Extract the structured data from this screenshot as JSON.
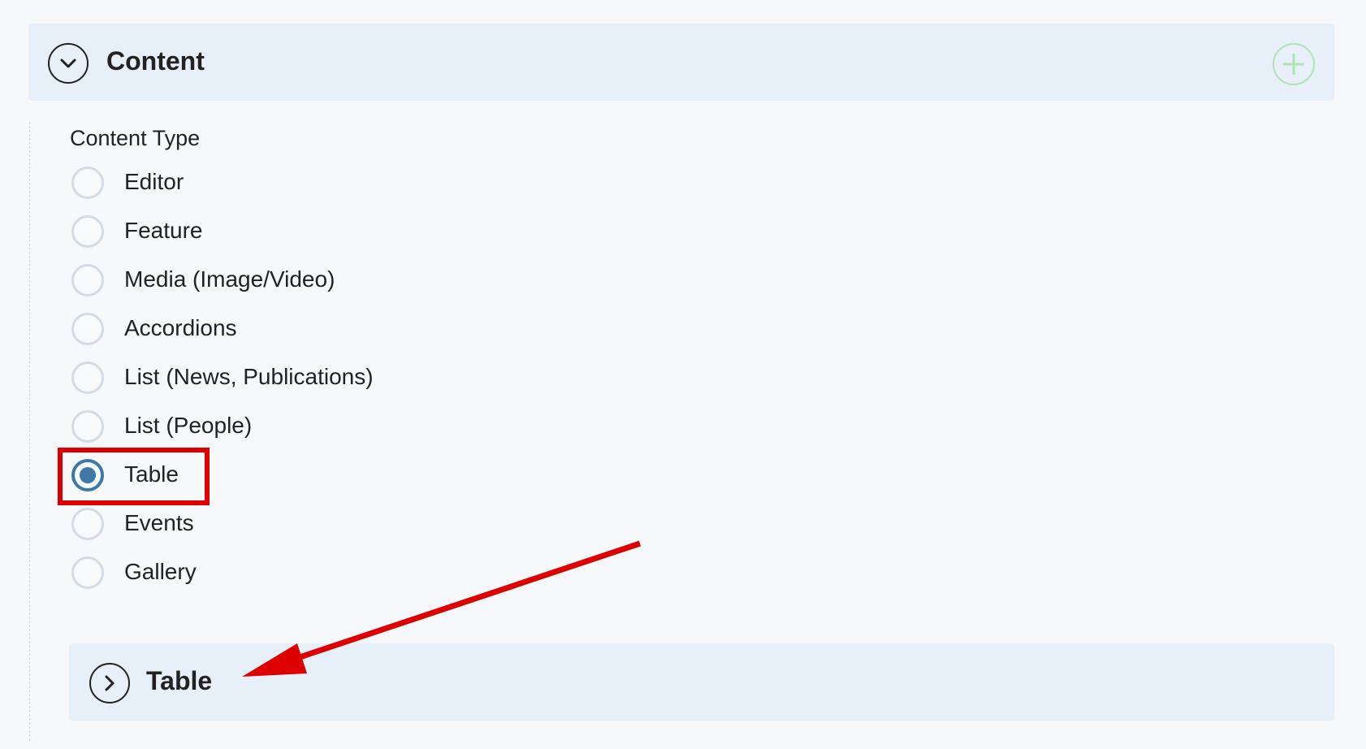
{
  "content_panel": {
    "title": "Content",
    "collapse_icon": "chevron-down-icon",
    "add_icon": "plus-icon"
  },
  "content_type": {
    "label": "Content Type",
    "options": [
      {
        "label": "Editor",
        "checked": false
      },
      {
        "label": "Feature",
        "checked": false
      },
      {
        "label": "Media (Image/Video)",
        "checked": false
      },
      {
        "label": "Accordions",
        "checked": false
      },
      {
        "label": "List (News, Publications)",
        "checked": false
      },
      {
        "label": "List (People)",
        "checked": false
      },
      {
        "label": "Table",
        "checked": true
      },
      {
        "label": "Events",
        "checked": false
      },
      {
        "label": "Gallery",
        "checked": false
      }
    ],
    "selected": "Table"
  },
  "table_panel": {
    "title": "Table",
    "expand_icon": "chevron-right-icon"
  },
  "colors": {
    "accent": "#3d78a8",
    "annotation": "#dc0000",
    "add": "#aee3b5",
    "panel": "#e7f0f9"
  }
}
